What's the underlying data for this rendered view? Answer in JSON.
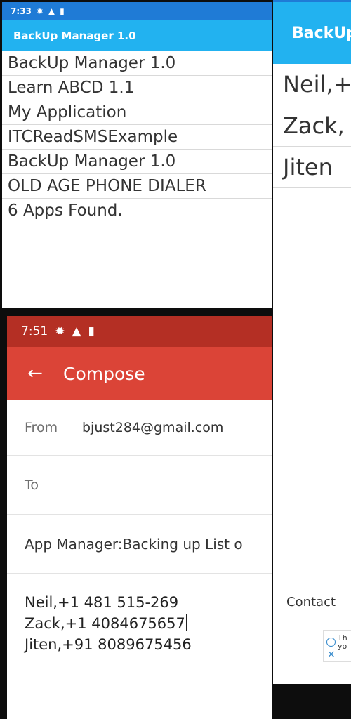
{
  "left_top": {
    "status_time": "7:33",
    "app_title": "BackUp Manager 1.0",
    "apps": [
      "BackUp Manager 1.0",
      "Learn ABCD 1.1",
      "My Application",
      "ITCReadSMSExample",
      "BackUp Manager 1.0",
      "OLD AGE PHONE DIALER"
    ],
    "footer": "6 Apps Found."
  },
  "right": {
    "app_title_partial": "BackUp",
    "contacts_partial": [
      "Neil,+",
      "Zack,",
      "Jiten"
    ],
    "bottom_label": "Contact",
    "ad_text_partial": [
      "Th",
      "yo"
    ]
  },
  "left_bottom": {
    "status_time": "7:51",
    "title": "Compose",
    "from_label": "From",
    "from_value": "bjust284@gmail.com",
    "to_label": "To",
    "to_value": "",
    "subject": "App Manager:Backing up List o",
    "body_lines": [
      "Neil,+1 481 515-269",
      "Zack,+1 4084675657",
      "Jiten,+91 8089675456"
    ]
  },
  "colors": {
    "blue_status": "#1f7bd6",
    "blue_appbar": "#22b2f0",
    "red_status": "#b42f24",
    "red_appbar": "#db4437"
  }
}
